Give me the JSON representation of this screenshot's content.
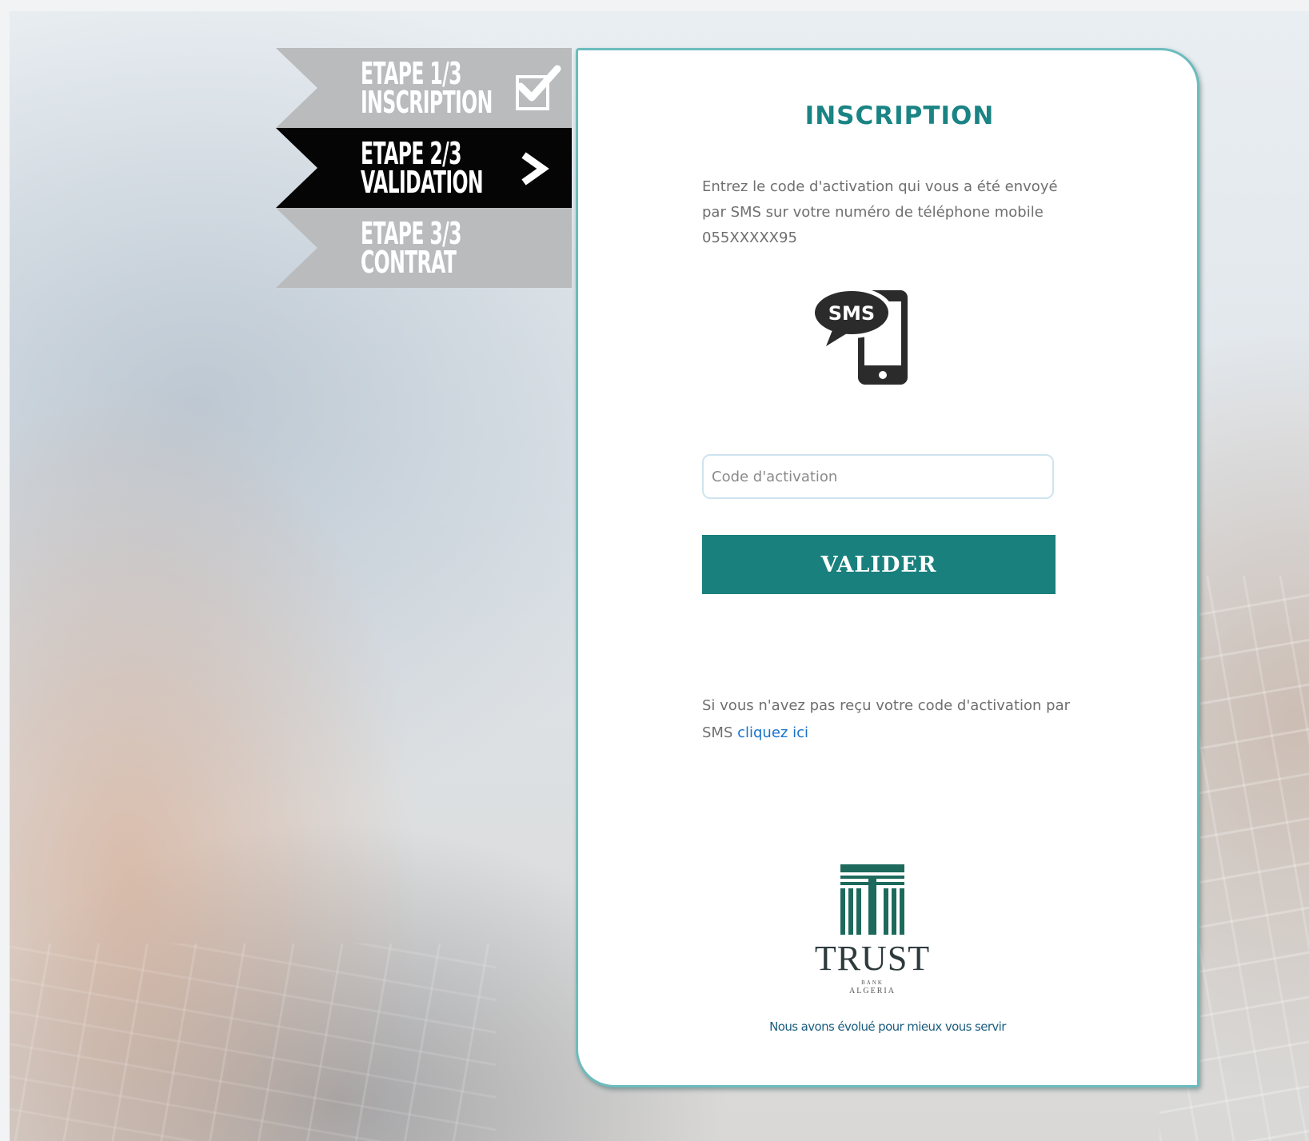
{
  "steps": [
    {
      "line1": "ETAPE 1/3",
      "line2": "INSCRIPTION",
      "state": "done",
      "indicator": "check-icon"
    },
    {
      "line1": "ETAPE 2/3",
      "line2": "VALIDATION",
      "state": "active",
      "indicator": "chevron-right-icon"
    },
    {
      "line1": "ETAPE 3/3",
      "line2": "CONTRAT",
      "state": "todo",
      "indicator": ""
    }
  ],
  "card": {
    "title": "INSCRIPTION",
    "intro": "Entrez le code d'activation qui vous a été envoyé par SMS sur votre numéro de téléphone mobile 055XXXXX95",
    "sms_icon_label": "SMS",
    "code_input": {
      "placeholder": "Code d'activation",
      "value": ""
    },
    "validate_label": "VALIDER",
    "resend_text": "Si vous n'avez pas reçu votre code d'activation par SMS ",
    "resend_link": "cliquez ici",
    "logo": {
      "word": "TRUST",
      "sub1": "BANK",
      "sub2": "ALGERIA"
    },
    "tagline": "Nous avons évolué pour mieux vous servir"
  },
  "colors": {
    "accent": "#19807d",
    "title": "#1a8384",
    "card_border": "#6cbcbd",
    "link": "#1a73c9",
    "step_active": "#050505",
    "step_inactive": "#b9bbbd"
  }
}
